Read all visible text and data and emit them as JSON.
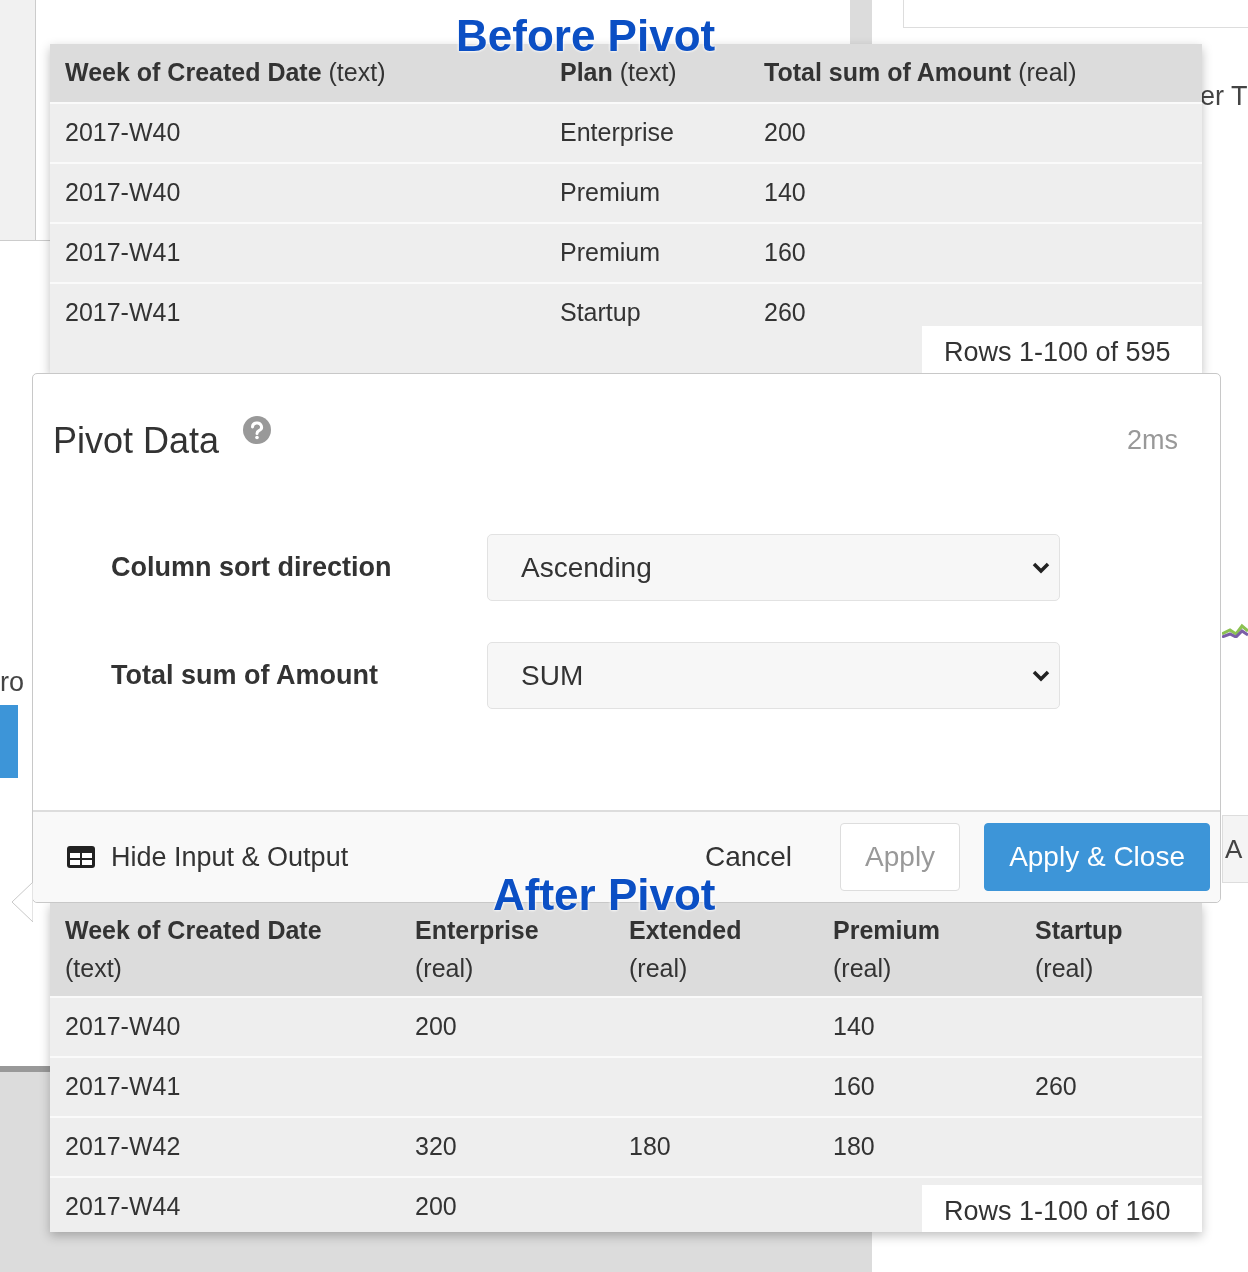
{
  "background": {
    "fragments": [
      {
        "text": "er T",
        "kind": "right"
      },
      {
        "text": "ro",
        "kind": "left"
      },
      {
        "text": "A",
        "kind": "button"
      }
    ]
  },
  "before": {
    "title": "Before Pivot",
    "columns": [
      {
        "name": "Week of Created Date",
        "type": "(text)"
      },
      {
        "name": "Plan",
        "type": "(text)"
      },
      {
        "name": "Total sum of Amount",
        "type": "(real)"
      }
    ],
    "rows": [
      [
        "2017-W40",
        "Enterprise",
        "200"
      ],
      [
        "2017-W40",
        "Premium",
        "140"
      ],
      [
        "2017-W41",
        "Premium",
        "160"
      ],
      [
        "2017-W41",
        "Startup",
        "260"
      ]
    ],
    "row_count": "Rows 1-100 of 595"
  },
  "modal": {
    "title": "Pivot Data",
    "timing": "2ms",
    "fields": [
      {
        "label": "Column sort direction",
        "value": "Ascending"
      },
      {
        "label": "Total sum of Amount",
        "value": "SUM"
      }
    ],
    "toggle": "Hide Input & Output",
    "buttons": [
      {
        "label": "Cancel",
        "kind": "link"
      },
      {
        "label": "Apply",
        "kind": "outline"
      },
      {
        "label": "Apply & Close",
        "kind": "primary"
      }
    ]
  },
  "after": {
    "title": "After Pivot",
    "columns": [
      {
        "name": "Week of Created Date",
        "type": "(text)"
      },
      {
        "name": "Enterprise",
        "type": "(real)"
      },
      {
        "name": "Extended",
        "type": "(real)"
      },
      {
        "name": "Premium",
        "type": "(real)"
      },
      {
        "name": "Startup",
        "type": "(real)"
      }
    ],
    "rows": [
      [
        "2017-W40",
        "200",
        null,
        "140",
        null
      ],
      [
        "2017-W41",
        null,
        null,
        "160",
        "260"
      ],
      [
        "2017-W42",
        "320",
        "180",
        "180",
        null
      ],
      [
        "2017-W44",
        "200",
        null,
        null,
        null
      ]
    ],
    "row_count": "Rows 1-100 of 160"
  }
}
